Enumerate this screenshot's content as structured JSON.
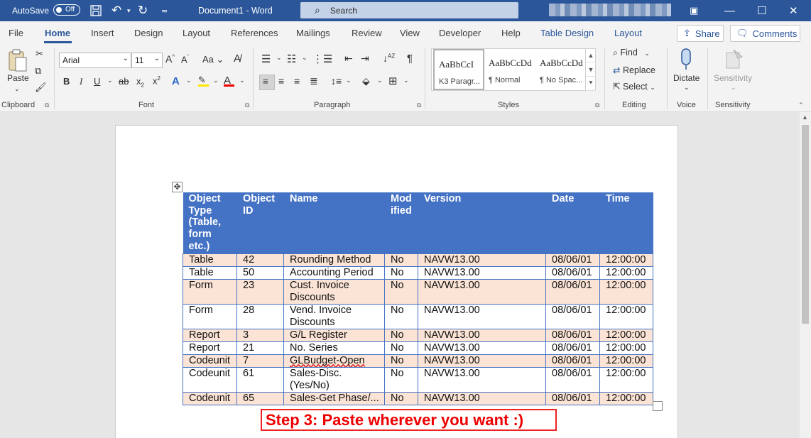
{
  "titlebar": {
    "autosave_label": "AutoSave",
    "autosave_state": "Off",
    "doc_title": "Document1  -  Word",
    "search_placeholder": "Search"
  },
  "tabs": [
    {
      "label": "File"
    },
    {
      "label": "Home"
    },
    {
      "label": "Insert"
    },
    {
      "label": "Design"
    },
    {
      "label": "Layout"
    },
    {
      "label": "References"
    },
    {
      "label": "Mailings"
    },
    {
      "label": "Review"
    },
    {
      "label": "View"
    },
    {
      "label": "Developer"
    },
    {
      "label": "Help"
    },
    {
      "label": "Table Design"
    },
    {
      "label": "Layout"
    }
  ],
  "share_label": "Share",
  "comments_label": "Comments",
  "ribbon": {
    "clipboard": {
      "label": "Clipboard",
      "paste_label": "Paste"
    },
    "font": {
      "label": "Font",
      "font_name": "Arial",
      "font_size": "11",
      "aa_label": "Aa"
    },
    "paragraph": {
      "label": "Paragraph"
    },
    "styles": {
      "label": "Styles",
      "items": [
        {
          "preview": "AaBbCcI",
          "name": "K3 Paragr..."
        },
        {
          "preview": "AaBbCcDd",
          "name": "¶ Normal"
        },
        {
          "preview": "AaBbCcDd",
          "name": "¶ No Spac..."
        }
      ]
    },
    "editing": {
      "label": "Editing",
      "find": "Find",
      "replace": "Replace",
      "select": "Select"
    },
    "voice": {
      "label": "Voice",
      "dictate": "Dictate"
    },
    "sensitivity": {
      "label": "Sensitivity",
      "button": "Sensitivity"
    }
  },
  "table": {
    "headers": [
      "Object Type (Table, form etc.)",
      "Object ID",
      "Name",
      "Mod ified",
      "Version",
      "Date",
      "Time"
    ],
    "rows": [
      [
        "Table",
        "42",
        "Rounding Method",
        "No",
        "NAVW13.00",
        "08/06/01",
        "12:00:00"
      ],
      [
        "Table",
        "50",
        "Accounting Period",
        "No",
        "NAVW13.00",
        "08/06/01",
        "12:00:00"
      ],
      [
        "Form",
        "23",
        "Cust. Invoice Discounts",
        "No",
        "NAVW13.00",
        "08/06/01",
        "12:00:00"
      ],
      [
        "Form",
        "28",
        "Vend. Invoice Discounts",
        "No",
        "NAVW13.00",
        "08/06/01",
        "12:00:00"
      ],
      [
        "Report",
        "3",
        "G/L Register",
        "No",
        "NAVW13.00",
        "08/06/01",
        "12:00:00"
      ],
      [
        "Report",
        "21",
        "No. Series",
        "No",
        "NAVW13.00",
        "08/06/01",
        "12:00:00"
      ],
      [
        "Codeunit",
        "7",
        "GLBudget-Open",
        "No",
        "NAVW13.00",
        "08/06/01",
        "12:00:00"
      ],
      [
        "Codeunit",
        "61",
        "Sales-Disc. (Yes/No)",
        "No",
        "NAVW13.00",
        "08/06/01",
        "12:00:00"
      ],
      [
        "Codeunit",
        "65",
        "Sales-Get Phase/...",
        "No",
        "NAVW13.00",
        "08/06/01",
        "12:00:00"
      ]
    ]
  },
  "caption": "Step 3: Paste wherever you want :)",
  "colors": {
    "titlebar": "#2b579a",
    "table_header": "#4472c4",
    "row_shade": "#fbe4d5",
    "caption": "#ff0000"
  }
}
